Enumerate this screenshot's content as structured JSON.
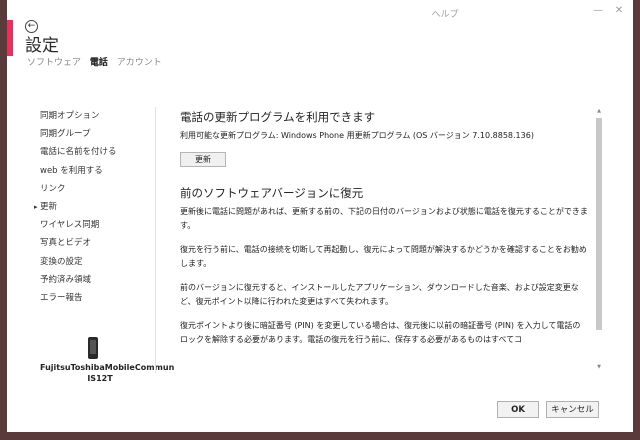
{
  "window": {
    "title": "ヘルプ",
    "min_glyph": "—",
    "close_glyph": "✕"
  },
  "header": {
    "back_glyph": "←",
    "title": "設定",
    "tabs": [
      {
        "label": "ソフトウェア",
        "active": false
      },
      {
        "label": "電話",
        "active": true
      },
      {
        "label": "アカウント",
        "active": false
      }
    ]
  },
  "sidebar": {
    "items": [
      {
        "label": "同期オプション"
      },
      {
        "label": "同期グループ"
      },
      {
        "label": "電話に名前を付ける"
      },
      {
        "label": "web を利用する"
      },
      {
        "label": "リンク"
      },
      {
        "label": "更新"
      },
      {
        "label": "ワイヤレス同期"
      },
      {
        "label": "写真とビデオ"
      },
      {
        "label": "変換の設定"
      },
      {
        "label": "予約済み領域"
      },
      {
        "label": "エラー報告"
      }
    ],
    "active_index": 5,
    "device_name": "FujitsuToshibaMobileCommun IS12T"
  },
  "content": {
    "update": {
      "heading": "電話の更新プログラムを利用できます",
      "info": "利用可能な更新プログラム: Windows Phone 用更新プログラム (OS バージョン 7.10.8858.136)",
      "button": "更新"
    },
    "restore": {
      "heading": "前のソフトウェアバージョンに復元",
      "p1": "更新後に電話に問題があれば、更新する前の、下記の日付のバージョンおよび状態に電話を復元することができます。",
      "p2": "復元を行う前に、電話の接続を切断して再起動し、復元によって問題が解決するかどうかを確認することをお勧めします。",
      "p3": "前のバージョンに復元すると、インストールしたアプリケーション、ダウンロードした音楽、および設定変更など、復元ポイント以降に行われた変更はすべて失われます。",
      "p4": "復元ポイントより後に暗証番号 (PIN) を変更している場合は、復元後に以前の暗証番号 (PIN) を入力して電話のロックを解除する必要があります。電話の復元を行う前に、保存する必要があるものはすべてコ"
    }
  },
  "footer": {
    "ok": "OK",
    "cancel": "キャンセル"
  },
  "colors": {
    "accent": "#e8315a"
  }
}
